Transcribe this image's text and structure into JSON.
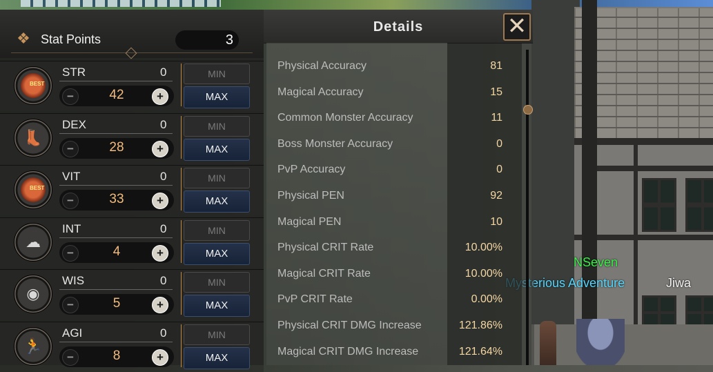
{
  "stat_panel": {
    "title": "Stat Points",
    "points": "3",
    "stats": [
      {
        "name": "STR",
        "base": "0",
        "value": "42",
        "best": true,
        "best_label": "BEST",
        "icon": "fist-icon",
        "min_label": "MIN",
        "max_label": "MAX"
      },
      {
        "name": "DEX",
        "base": "0",
        "value": "28",
        "best": false,
        "icon": "boot-icon",
        "min_label": "MIN",
        "max_label": "MAX"
      },
      {
        "name": "VIT",
        "base": "0",
        "value": "33",
        "best": true,
        "best_label": "BEST",
        "icon": "heart-icon",
        "min_label": "MIN",
        "max_label": "MAX"
      },
      {
        "name": "INT",
        "base": "0",
        "value": "4",
        "best": false,
        "icon": "brain-icon",
        "min_label": "MIN",
        "max_label": "MAX"
      },
      {
        "name": "WIS",
        "base": "0",
        "value": "5",
        "best": false,
        "icon": "head-eye-icon",
        "min_label": "MIN",
        "max_label": "MAX"
      },
      {
        "name": "AGI",
        "base": "0",
        "value": "8",
        "best": false,
        "icon": "running-man-icon",
        "min_label": "MIN",
        "max_label": "MAX"
      }
    ]
  },
  "details": {
    "title": "Details",
    "rows": [
      {
        "label": "Physical Accuracy",
        "value": "81"
      },
      {
        "label": "Magical Accuracy",
        "value": "15"
      },
      {
        "label": "Common Monster Accuracy",
        "value": "11"
      },
      {
        "label": "Boss Monster Accuracy",
        "value": "0"
      },
      {
        "label": "PvP Accuracy",
        "value": "0"
      },
      {
        "label": "Physical PEN",
        "value": "92"
      },
      {
        "label": "Magical PEN",
        "value": "10"
      },
      {
        "label": "Physical CRIT Rate",
        "value": "10.00%"
      },
      {
        "label": "Magical CRIT Rate",
        "value": "10.00%"
      },
      {
        "label": "PvP CRIT Rate",
        "value": "0.00%"
      },
      {
        "label": "Physical CRIT DMG Increase",
        "value": "121.86%"
      },
      {
        "label": "Magical CRIT DMG Increase",
        "value": "121.64%"
      }
    ]
  },
  "world": {
    "player_name": "NSeven",
    "guild_name": "Mysterious Adventure",
    "other_name": "Jiwa"
  },
  "colors": {
    "stat_value": "#f3bc7f",
    "detail_value": "#f5d7a3",
    "player_name": "#3cf04a",
    "guild_name": "#55d8ff",
    "max_button": "#1c2a42",
    "accent": "#c68a3c"
  }
}
